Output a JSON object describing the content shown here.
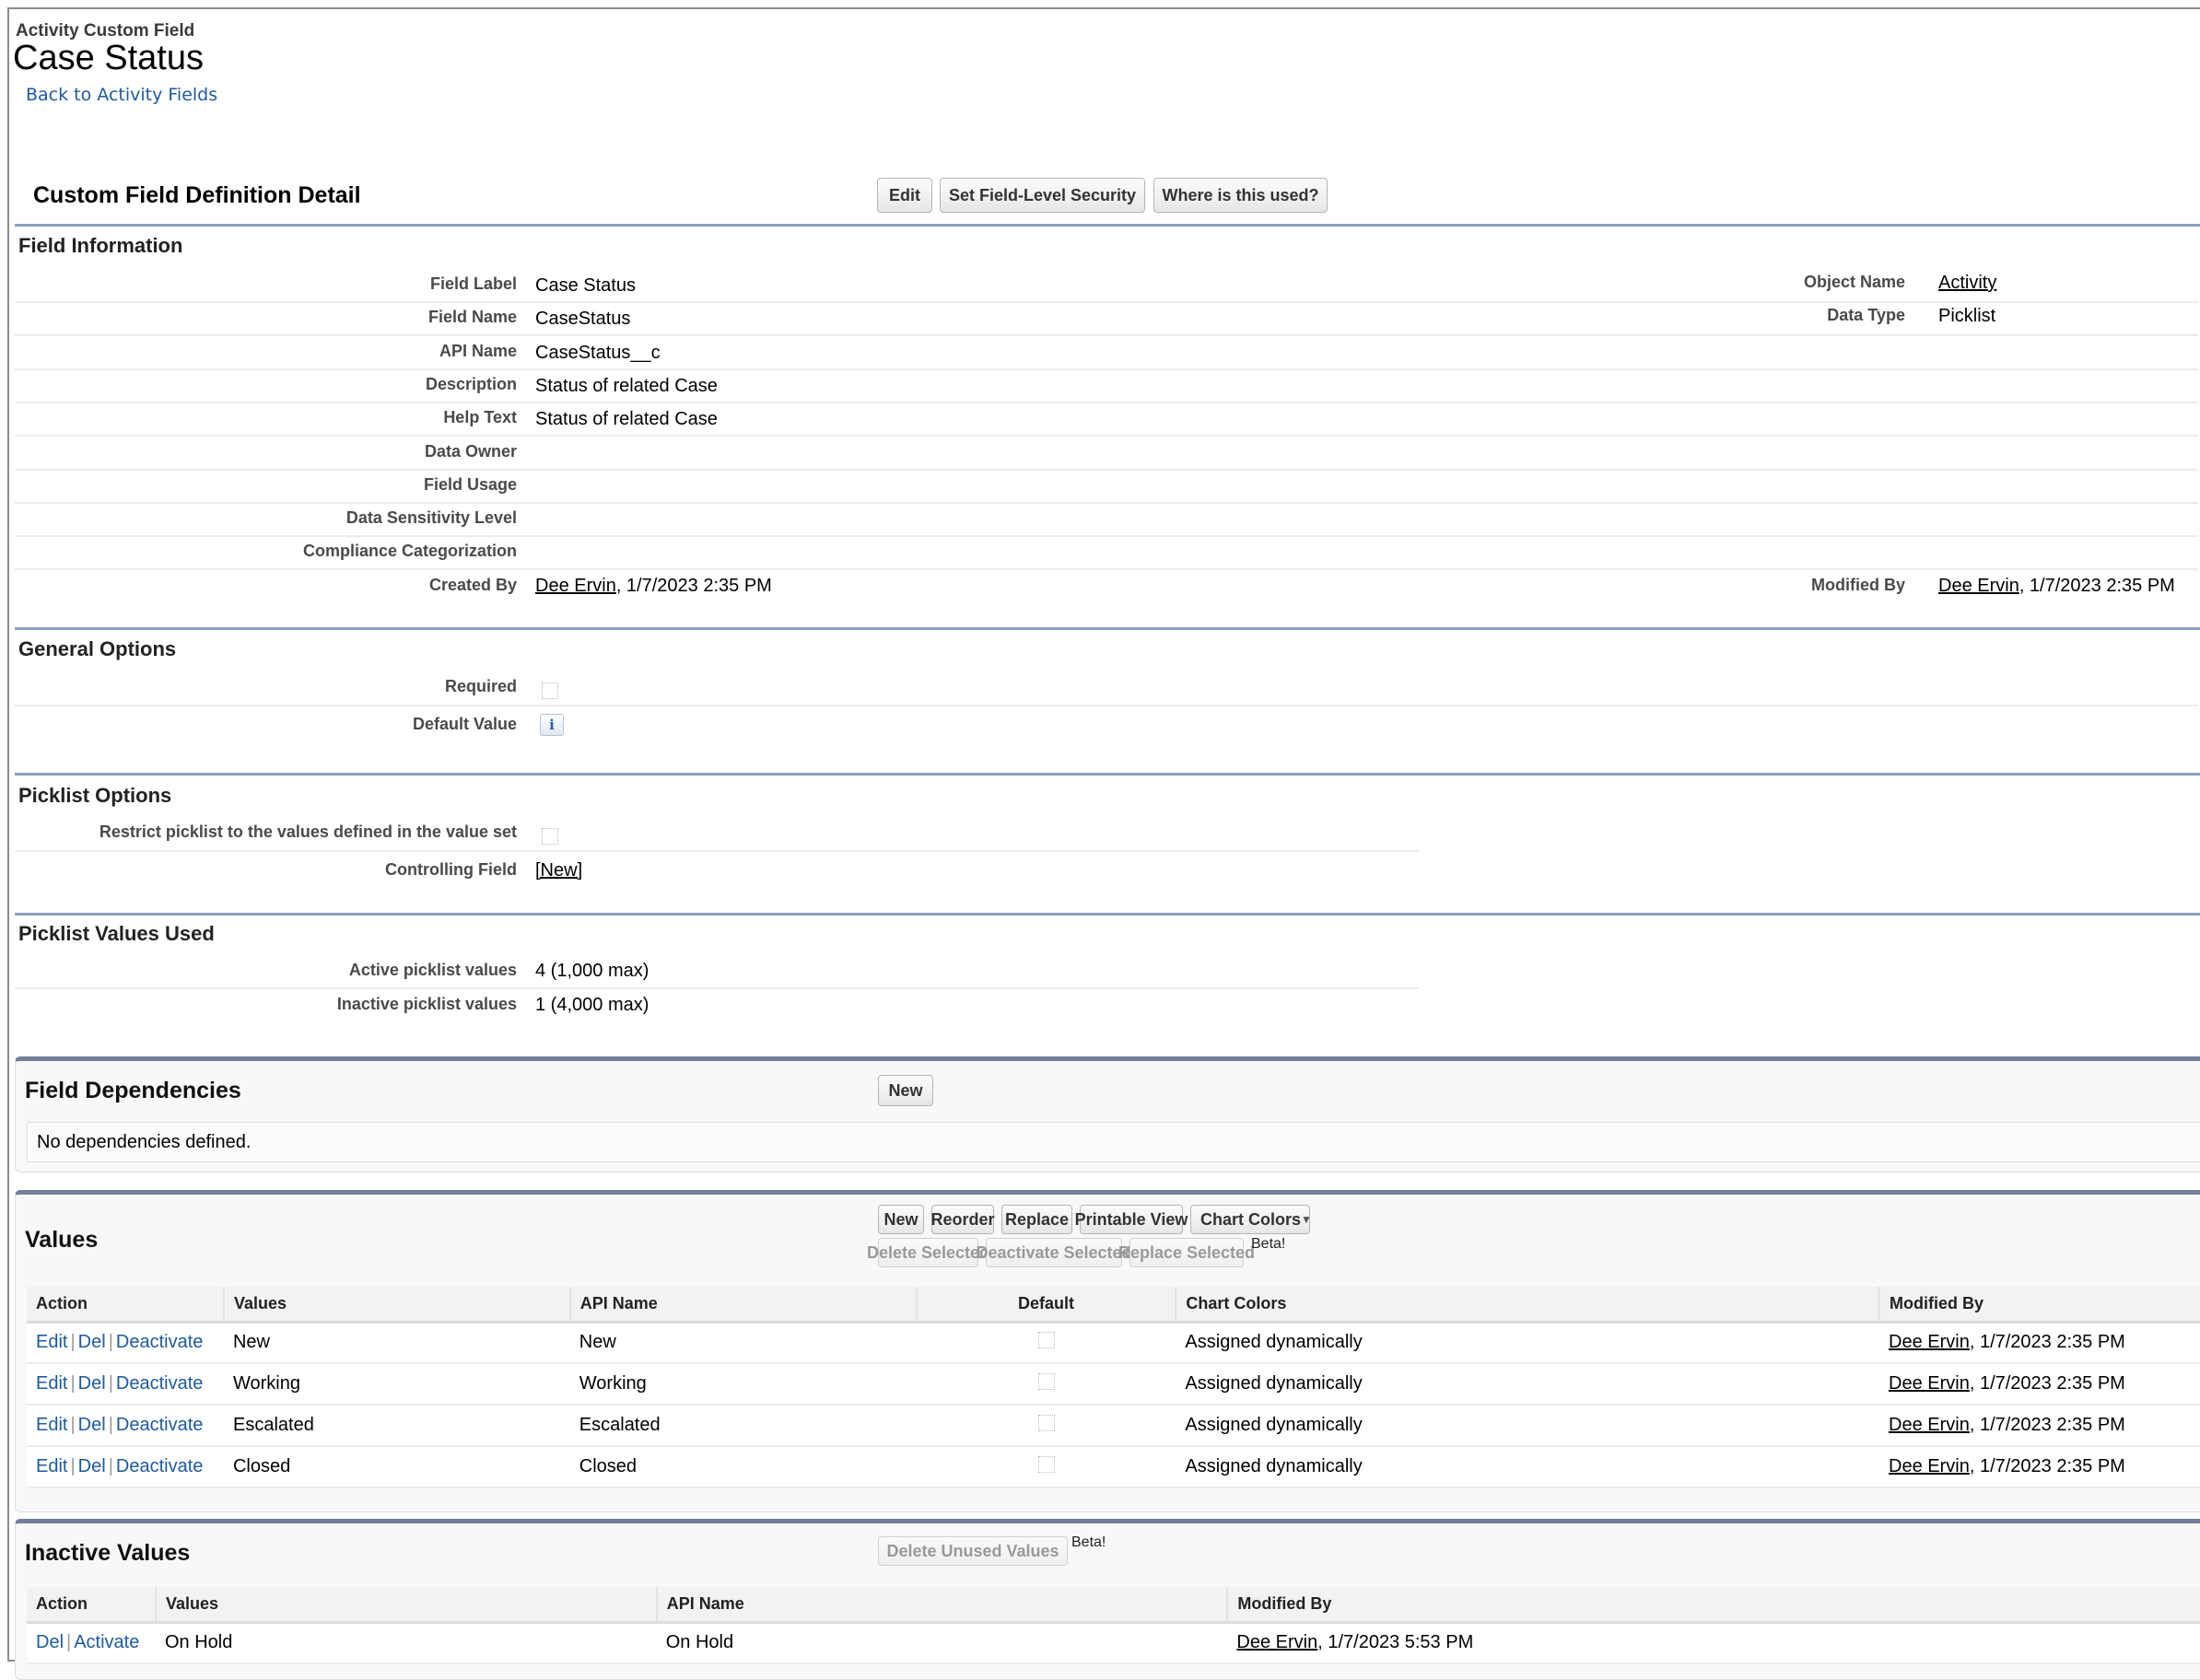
{
  "header": {
    "breadcrumb": "Activity Custom Field",
    "title": "Case Status",
    "back_link": "Back to Activity Fields"
  },
  "detail": {
    "title": "Custom Field Definition Detail",
    "buttons": {
      "edit": "Edit",
      "set_fls": "Set Field-Level Security",
      "where_used": "Where is this used?"
    }
  },
  "field_information": {
    "heading": "Field Information",
    "rows": [
      {
        "label": "Field Label",
        "value": "Case Status"
      },
      {
        "label": "Field Name",
        "value": "CaseStatus"
      },
      {
        "label": "API Name",
        "value": "CaseStatus__c"
      },
      {
        "label": "Description",
        "value": "Status of related Case"
      },
      {
        "label": "Help Text",
        "value": "Status of related Case"
      },
      {
        "label": "Data Owner",
        "value": ""
      },
      {
        "label": "Field Usage",
        "value": ""
      },
      {
        "label": "Data Sensitivity Level",
        "value": ""
      },
      {
        "label": "Compliance Categorization",
        "value": ""
      }
    ],
    "created_by": {
      "label": "Created By",
      "user": "Dee Ervin",
      "date": ", 1/7/2023 2:35 PM"
    },
    "right": {
      "object_name": {
        "label": "Object Name",
        "value": "Activity"
      },
      "data_type": {
        "label": "Data Type",
        "value": "Picklist"
      },
      "modified_by": {
        "label": "Modified By",
        "user": "Dee Ervin",
        "date": ", 1/7/2023 2:35 PM"
      }
    }
  },
  "general_options": {
    "heading": "General Options",
    "required": {
      "label": "Required",
      "checked": false
    },
    "default_value": {
      "label": "Default Value",
      "icon": "info-icon",
      "glyph": "i"
    }
  },
  "picklist_options": {
    "heading": "Picklist Options",
    "restrict": {
      "label": "Restrict picklist to the values defined in the value set",
      "checked": false
    },
    "controlling_field": {
      "label": "Controlling Field",
      "value": "[New]"
    }
  },
  "picklist_values_used": {
    "heading": "Picklist Values Used",
    "active": {
      "label": "Active picklist values",
      "value": "4 (1,000 max)"
    },
    "inactive": {
      "label": "Inactive picklist values",
      "value": "1 (4,000 max)"
    }
  },
  "field_dependencies": {
    "title": "Field Dependencies",
    "new_button": "New",
    "empty_text": "No dependencies defined."
  },
  "values": {
    "title": "Values",
    "buttons": {
      "new": "New",
      "reorder": "Reorder",
      "replace": "Replace",
      "printable_view": "Printable View",
      "chart_colors": "Chart Colors",
      "chart_colors_arrow": "▼",
      "delete_selected": "Delete Selected",
      "deactivate_selected": "Deactivate Selected",
      "replace_selected": "Replace Selected"
    },
    "beta": "Beta!",
    "columns": [
      "Action",
      "Values",
      "API Name",
      "Default",
      "Chart Colors",
      "Modified By"
    ],
    "action_links": {
      "edit": "Edit",
      "del": "Del",
      "deactivate": "Deactivate",
      "sep": "|"
    },
    "rows": [
      {
        "value": "New",
        "api_name": "New",
        "default": false,
        "chart_colors": "Assigned dynamically",
        "modified_user": "Dee Ervin",
        "modified_date": ", 1/7/2023 2:35 PM"
      },
      {
        "value": "Working",
        "api_name": "Working",
        "default": false,
        "chart_colors": "Assigned dynamically",
        "modified_user": "Dee Ervin",
        "modified_date": ", 1/7/2023 2:35 PM"
      },
      {
        "value": "Escalated",
        "api_name": "Escalated",
        "default": false,
        "chart_colors": "Assigned dynamically",
        "modified_user": "Dee Ervin",
        "modified_date": ", 1/7/2023 2:35 PM"
      },
      {
        "value": "Closed",
        "api_name": "Closed",
        "default": false,
        "chart_colors": "Assigned dynamically",
        "modified_user": "Dee Ervin",
        "modified_date": ", 1/7/2023 2:35 PM"
      }
    ]
  },
  "inactive_values": {
    "title": "Inactive Values",
    "delete_unused_button": "Delete Unused Values",
    "beta": "Beta!",
    "columns": [
      "Action",
      "Values",
      "API Name",
      "Modified By"
    ],
    "action_links": {
      "del": "Del",
      "activate": "Activate",
      "sep": "|"
    },
    "rows": [
      {
        "value": "On Hold",
        "api_name": "On Hold",
        "modified_user": "Dee Ervin",
        "modified_date": ", 1/7/2023 5:53 PM"
      }
    ]
  },
  "colors": {
    "link_blue": "#1e5aa0",
    "section_rule": "#8da0be",
    "box_header": "#747f98"
  }
}
